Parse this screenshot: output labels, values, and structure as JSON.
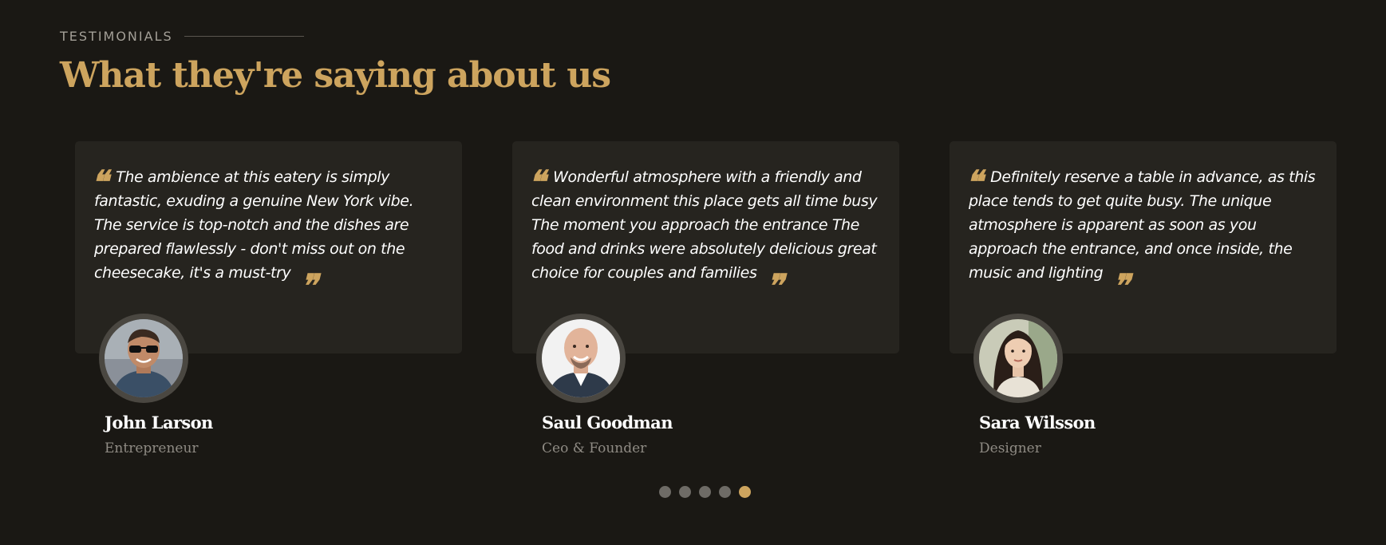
{
  "section": {
    "eyebrow": "TESTIMONIALS",
    "title": "What they're saying about us"
  },
  "colors": {
    "accent": "#cda45e",
    "background": "#1a1814",
    "card": "#26241f"
  },
  "testimonials": [
    {
      "quote": "The ambience at this eatery is simply fantastic, exuding a genuine New York vibe. The service is top-notch and the dishes are prepared flawlessly - don't miss out on the cheesecake, it's a must-try",
      "name": "John Larson",
      "role": "Entrepreneur",
      "avatar": "avatar-john-larson"
    },
    {
      "quote": "Wonderful atmosphere with a friendly and clean environment this place gets all time busy The moment you approach the entrance The food and drinks were absolutely delicious great choice for couples and families",
      "name": "Saul Goodman",
      "role": "Ceo & Founder",
      "avatar": "avatar-saul-goodman"
    },
    {
      "quote": "Definitely reserve a table in advance, as this place tends to get quite busy. The unique atmosphere is apparent as soon as you approach the entrance, and once inside, the music and lighting",
      "name": "Sara Wilsson",
      "role": "Designer",
      "avatar": "avatar-sara-wilsson"
    }
  ],
  "quote_open_glyph": "❝",
  "quote_close_glyph": "❞",
  "pagination": {
    "count": 5,
    "active_index": 4
  }
}
